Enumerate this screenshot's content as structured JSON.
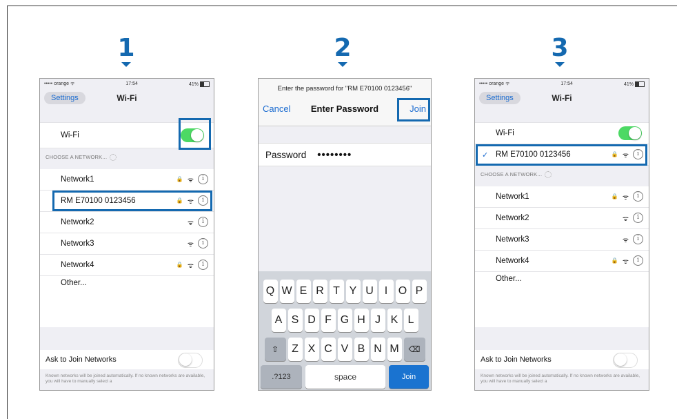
{
  "steps": [
    "1",
    "2",
    "3"
  ],
  "status_bar": {
    "carrier": "••••• orange",
    "wifi": "ᯤ",
    "time": "17:54",
    "battery": "41%"
  },
  "wifi_screen": {
    "back_label": "Settings",
    "title": "Wi-Fi",
    "wifi_label": "Wi-Fi",
    "choose_header": "CHOOSE A NETWORK...",
    "networks": [
      "Network1",
      "RM E70100 0123456",
      "Network2",
      "Network3",
      "Network4"
    ],
    "other_label": "Other...",
    "ask_label": "Ask to Join Networks",
    "footnote": "Known networks will be joined automatically. If no known networks are available, you will have to manually select a"
  },
  "password_screen": {
    "prompt": "Enter the password for \"RM E70100 0123456\"",
    "cancel_label": "Cancel",
    "title": "Enter Password",
    "join_label": "Join",
    "password_label": "Password",
    "password_value": "••••••••",
    "keyboard": {
      "row1": [
        "Q",
        "W",
        "E",
        "R",
        "T",
        "Y",
        "U",
        "I",
        "O",
        "P"
      ],
      "row2": [
        "A",
        "S",
        "D",
        "F",
        "G",
        "H",
        "J",
        "K",
        "L"
      ],
      "row3": [
        "Z",
        "X",
        "C",
        "V",
        "B",
        "N",
        "M"
      ],
      "shift": "⇧",
      "delete": "⌫",
      "numbers": ".?123",
      "space": "space",
      "return": "Join"
    }
  },
  "colors": {
    "accent": "#1469b0",
    "ios_blue": "#1a6bd0",
    "switch_on": "#4cd964"
  },
  "icons": {
    "lock": "🔒",
    "wifi": "ᯤ",
    "info": "i",
    "check": "✓"
  }
}
